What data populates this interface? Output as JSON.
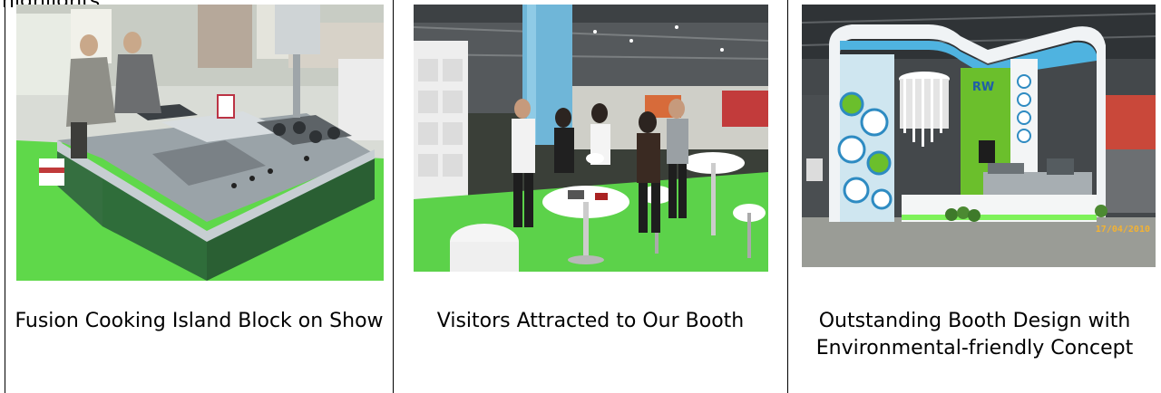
{
  "top_fragment": "highlights",
  "gallery": [
    {
      "caption": "Fusion Cooking Island Block on Show"
    },
    {
      "caption": "Visitors Attracted to Our Booth"
    },
    {
      "caption": "Outstanding Booth Design with Environmental-friendly Concept"
    }
  ],
  "booth_overlays": {
    "logo_text": "RW",
    "date_stamp": "17/04/2010"
  },
  "colors": {
    "carpet_green": "#5fd84a",
    "steel": "#b9c0c4",
    "cabinet_green": "#2f6d3a",
    "booth_green": "#6bbf2c",
    "booth_white": "#f2f4f5"
  }
}
